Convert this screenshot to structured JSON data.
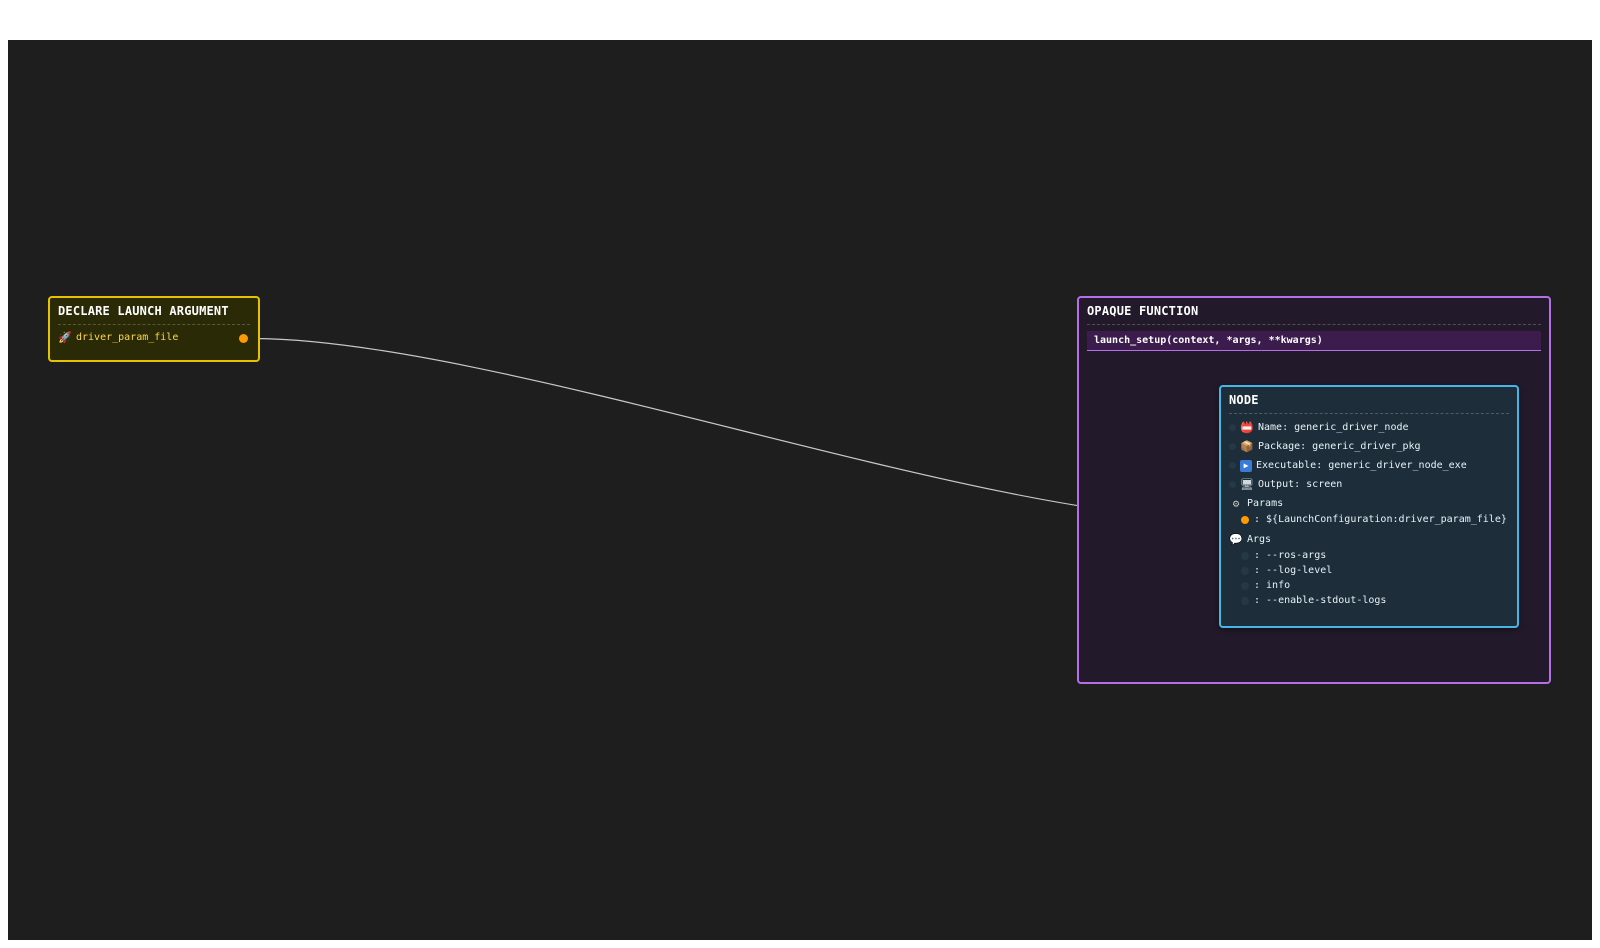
{
  "declare_argument": {
    "title": "DECLARE LAUNCH ARGUMENT",
    "name": "driver_param_file",
    "icon": "rocket-icon"
  },
  "opaque_function": {
    "title": "OPAQUE FUNCTION",
    "signature": "launch_setup(context, *args, **kwargs)"
  },
  "node": {
    "title": "NODE",
    "name_label": "Name: generic_driver_node",
    "package_label": "Package: generic_driver_pkg",
    "executable_label": "Executable: generic_driver_node_exe",
    "output_label": "Output: screen",
    "params_label": "Params",
    "params": [
      {
        "value": ": ${LaunchConfiguration:driver_param_file}"
      }
    ],
    "args_label": "Args",
    "args": [
      {
        "value": ": --ros-args"
      },
      {
        "value": ": --log-level"
      },
      {
        "value": ": info"
      },
      {
        "value": ": --enable-stdout-logs"
      }
    ]
  },
  "colors": {
    "background": "#1e1e1e",
    "declare_border": "#e6c300",
    "opaque_border": "#b46ee6",
    "node_border": "#47b6e6",
    "port": "#ff9a00",
    "edge": "#c8c8c8"
  }
}
